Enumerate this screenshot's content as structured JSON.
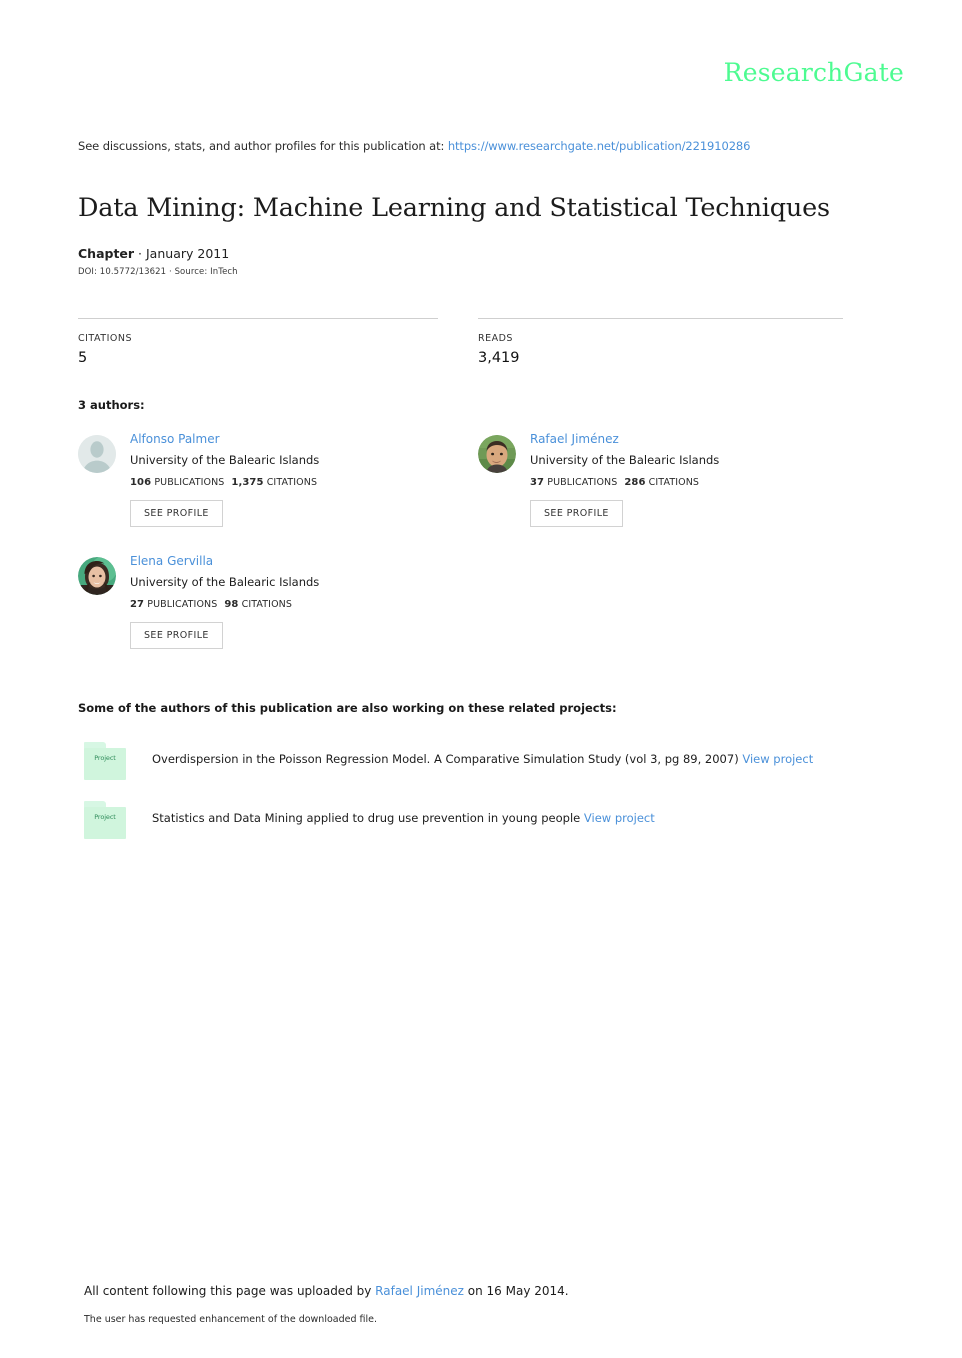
{
  "brand": {
    "name": "ResearchGate",
    "color": "#4dfb91"
  },
  "discussion": {
    "prefix": "See discussions, stats, and author profiles for this publication at:",
    "url": "https://www.researchgate.net/publication/221910286"
  },
  "publication": {
    "title": "Data Mining: Machine Learning and Statistical Techniques",
    "type": "Chapter",
    "date": "January 2011",
    "type_separator": " · ",
    "doi_line": "DOI: 10.5772/13621 · Source: InTech"
  },
  "stats": {
    "citations": {
      "label": "CITATIONS",
      "value": "5"
    },
    "reads": {
      "label": "READS",
      "value": "3,419"
    }
  },
  "authors_section": {
    "heading": "3 authors:",
    "see_profile_label": "SEE PROFILE",
    "publications_label": "PUBLICATIONS",
    "citations_label": "CITATIONS",
    "authors": [
      {
        "name": "Alfonso Palmer",
        "affiliation": "University of the Balearic Islands",
        "publications": "106",
        "citations": "1,375",
        "avatar": "default-silhouette-avatar"
      },
      {
        "name": "Rafael Jiménez",
        "affiliation": "University of the Balearic Islands",
        "publications": "37",
        "citations": "286",
        "avatar": "photo-avatar-male"
      },
      {
        "name": "Elena Gervilla",
        "affiliation": "University of the Balearic Islands",
        "publications": "27",
        "citations": "98",
        "avatar": "photo-avatar-female"
      }
    ]
  },
  "projects_section": {
    "heading": "Some of the authors of this publication are also working on these related projects:",
    "folder_icon_label": "Project",
    "view_project_label": "View project",
    "projects": [
      {
        "title": "Overdispersion in the Poisson Regression Model. A Comparative Simulation Study (vol 3, pg 89, 2007)"
      },
      {
        "title": "Statistics and Data Mining applied to drug use prevention in young people"
      }
    ]
  },
  "footer": {
    "uploaded_prefix": "All content following this page was uploaded by ",
    "uploader": "Rafael Jiménez",
    "uploaded_suffix": " on 16 May 2014.",
    "enhancement_note": "The user has requested enhancement of the downloaded file."
  },
  "colors": {
    "link": "#4a90d9",
    "brand_green": "#4dfb91",
    "folder_green": "#d0f5dd"
  }
}
